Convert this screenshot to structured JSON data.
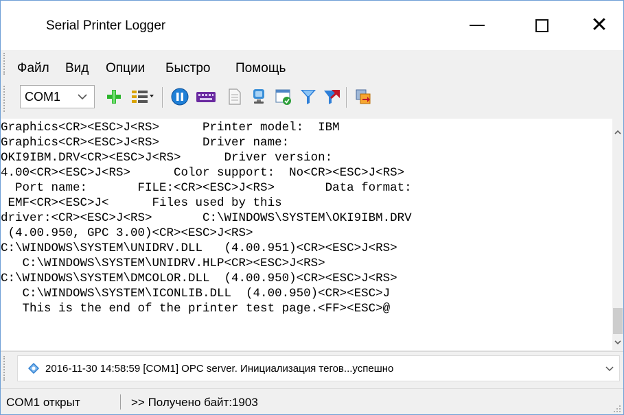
{
  "window": {
    "title": "Serial Printer Logger",
    "controls": {
      "minimize": "minimize",
      "maximize": "maximize",
      "close": "close"
    }
  },
  "menu": {
    "items": [
      {
        "label": "Файл"
      },
      {
        "label": "Вид"
      },
      {
        "label": "Опции"
      },
      {
        "label": "Быстро"
      },
      {
        "label": "Помощь"
      }
    ]
  },
  "toolbar": {
    "port_select": {
      "value": "COM1"
    },
    "buttons": [
      {
        "icon": "add-plus-icon",
        "color": "#2bb52b"
      },
      {
        "icon": "list-settings-icon",
        "color": "#d9a300"
      },
      {
        "icon": "pause-icon",
        "color": "#1f7fd6"
      },
      {
        "icon": "keyboard-icon",
        "color": "#7a2fb0"
      },
      {
        "icon": "document-icon",
        "color": "#9a9a9a"
      },
      {
        "icon": "display-icon",
        "color": "#3a8fd8"
      },
      {
        "icon": "window-check-icon",
        "color": "#2e9f3a"
      },
      {
        "icon": "filter-icon",
        "color": "#2e7fd8"
      },
      {
        "icon": "filter-arrow-icon",
        "color": "#c0182a"
      },
      {
        "icon": "export-icon",
        "color": "#e07a10"
      }
    ]
  },
  "log": {
    "lines": [
      "Graphics<CR><ESC>J<RS>      Printer model:  IBM",
      "Graphics<CR><ESC>J<RS>      Driver name:",
      "OKI9IBM.DRV<CR><ESC>J<RS>      Driver version:",
      "4.00<CR><ESC>J<RS>      Color support:  No<CR><ESC>J<RS>",
      "  Port name:       FILE:<CR><ESC>J<RS>       Data format:",
      " EMF<CR><ESC>J<      Files used by this",
      "driver:<CR><ESC>J<RS>       C:\\WINDOWS\\SYSTEM\\OKI9IBM.DRV",
      " (4.00.950, GPC 3.00)<CR><ESC>J<RS>",
      "C:\\WINDOWS\\SYSTEM\\UNIDRV.DLL   (4.00.951)<CR><ESC>J<RS>",
      "   C:\\WINDOWS\\SYSTEM\\UNIDRV.HLP<CR><ESC>J<RS>",
      "C:\\WINDOWS\\SYSTEM\\DMCOLOR.DLL  (4.00.950)<CR><ESC>J<RS>",
      "   C:\\WINDOWS\\SYSTEM\\ICONLIB.DLL  (4.00.950)<CR><ESC>J",
      "   This is the end of the printer test page.<FF><ESC>@"
    ]
  },
  "event_log": {
    "selected": "2016-11-30 14:58:59 [COM1] OPC server. Инициализация тегов...успешно"
  },
  "statusbar": {
    "port_status": "COM1 открыт",
    "received": ">> Получено байт:1903"
  }
}
